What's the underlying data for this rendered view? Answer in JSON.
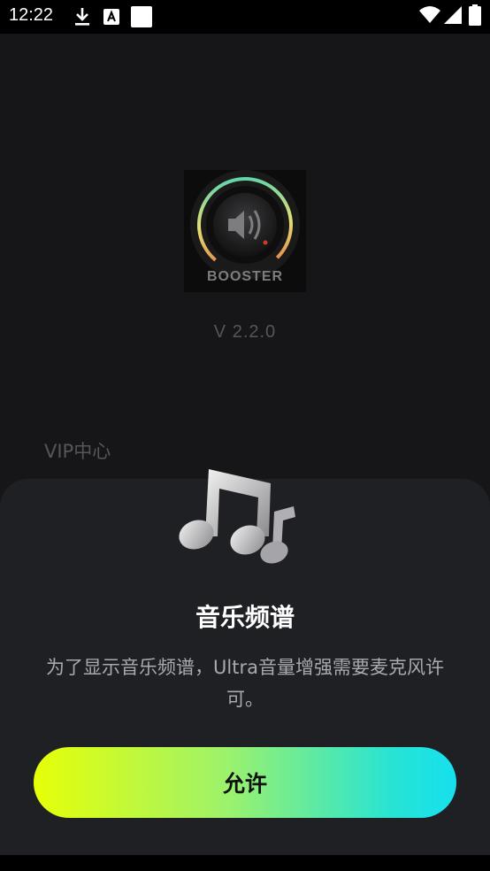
{
  "status_bar": {
    "time": "12:22",
    "icons": [
      "download-icon",
      "font-icon",
      "notification-square-icon",
      "wifi-icon",
      "signal-icon",
      "battery-icon"
    ]
  },
  "background_page": {
    "logo_icon": "booster-speaker-icon",
    "logo_text": "BOOSTER",
    "version": "V 2.2.0",
    "vip_label": "VIP中心"
  },
  "permission_sheet": {
    "hero_icon": "music-notes-waveform-icon",
    "title": "音乐频谱",
    "description": "为了显示音乐频谱，Ultra音量增强需要麦克风许可。",
    "allow_label": "允许"
  },
  "colors": {
    "sheet_bg": "#1f2024",
    "gradient_start": "#e6ff07",
    "gradient_end": "#16e0ee"
  }
}
